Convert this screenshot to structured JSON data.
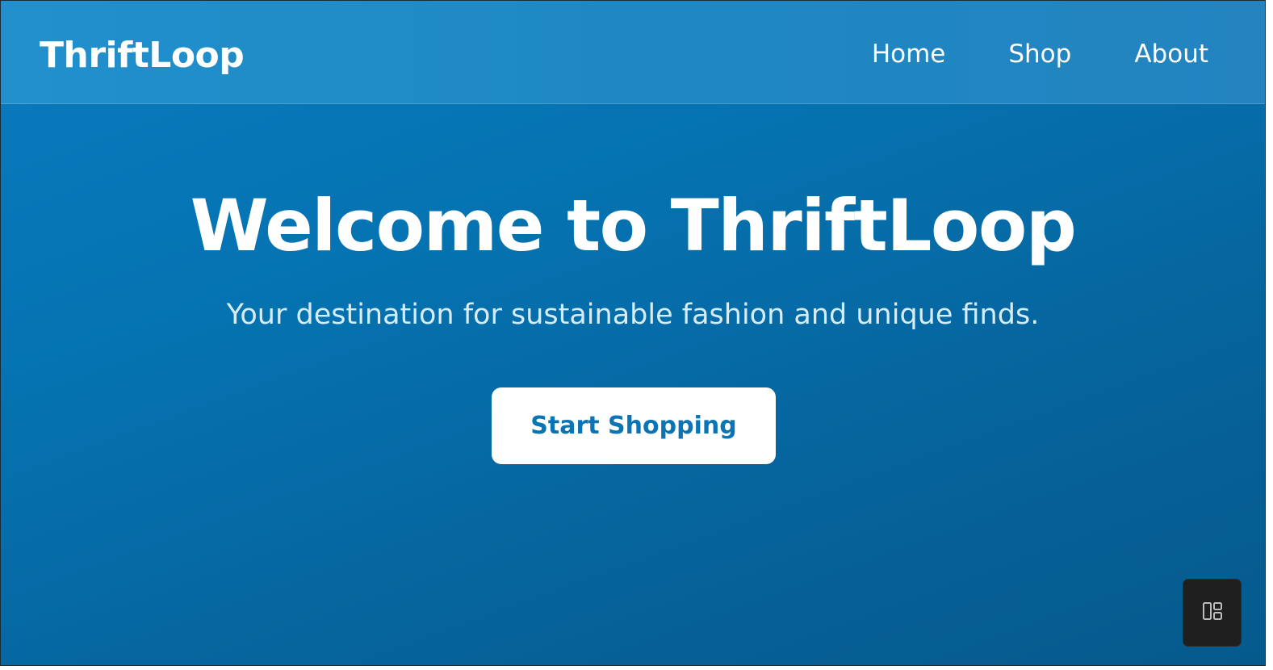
{
  "navbar": {
    "brand": "ThriftLoop",
    "links": [
      {
        "label": "Home"
      },
      {
        "label": "Shop"
      },
      {
        "label": "About"
      }
    ]
  },
  "hero": {
    "title": "Welcome to ThriftLoop",
    "subtitle": "Your destination for sustainable fashion and unique finds.",
    "cta_label": "Start Shopping"
  },
  "corner_widget": {
    "icon": "layout-icon"
  },
  "colors": {
    "background_gradient_start": "#0a7bc0",
    "background_gradient_end": "#055a8c",
    "navbar": "#2190cc",
    "cta_background": "#ffffff",
    "cta_text": "#0a74b5",
    "widget_background": "#1f1f1f"
  }
}
